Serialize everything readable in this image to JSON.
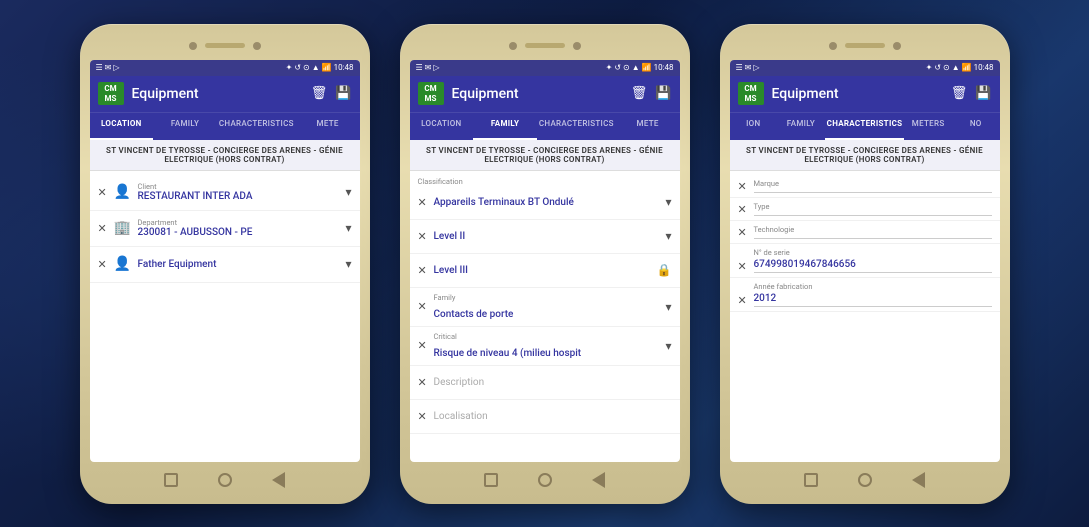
{
  "phones": [
    {
      "id": "phone1",
      "status_bar": {
        "left_icons": "☰ ✉ ▷",
        "right_icons": "✦ ↺ ⊙ ▲ 📶 🔋 10:48"
      },
      "header": {
        "logo_line1": "CM",
        "logo_line2": "MS",
        "title": "Equipment",
        "icon_trash": "🗑",
        "icon_save": "💾"
      },
      "tabs": [
        {
          "label": "LOCATION",
          "active": true
        },
        {
          "label": "FAMILY",
          "active": false
        },
        {
          "label": "CHARACTERISTICS",
          "active": false
        },
        {
          "label": "METE",
          "active": false
        }
      ],
      "breadcrumb": "ST VINCENT DE TYROSSE - CONCIERGE DES ARENES - GÉNIE ELECTRIQUE (HORS CONTRAT)",
      "rows": [
        {
          "type": "field",
          "label": "Client",
          "value": "RESTAURANT INTER ADA",
          "icon": "👤",
          "has_chevron": true
        },
        {
          "type": "field",
          "label": "Department",
          "value": "230081 - AUBUSSON - PE",
          "icon": "🏢",
          "has_chevron": true
        },
        {
          "type": "field",
          "label": "",
          "value": "Father Equipment",
          "icon": "👤",
          "has_chevron": true
        }
      ]
    },
    {
      "id": "phone2",
      "status_bar": {
        "left_icons": "☰ ✉ ▷",
        "right_icons": "✦ ↺ ⊙ ▲ 📶 🔋 10:48"
      },
      "header": {
        "logo_line1": "CM",
        "logo_line2": "MS",
        "title": "Equipment",
        "icon_trash": "🗑",
        "icon_save": "💾"
      },
      "tabs": [
        {
          "label": "LOCATION",
          "active": false
        },
        {
          "label": "FAMILY",
          "active": true
        },
        {
          "label": "CHARACTERISTICS",
          "active": false
        },
        {
          "label": "METE",
          "active": false
        }
      ],
      "breadcrumb": "ST VINCENT DE TYROSSE - CONCIERGE DES ARENES - GÉNIE ELECTRIQUE (HORS CONTRAT)",
      "classif_label": "Classification",
      "rows": [
        {
          "type": "classif",
          "value": "Appareils Terminaux BT Ondulé",
          "has_chevron": true,
          "locked": false
        },
        {
          "type": "classif",
          "value": "Level II",
          "has_chevron": true,
          "locked": false
        },
        {
          "type": "classif",
          "value": "Level III",
          "has_chevron": false,
          "locked": true
        },
        {
          "type": "field",
          "sub_label": "Family",
          "value": "Contacts de porte",
          "has_chevron": true,
          "locked": false
        },
        {
          "type": "field",
          "sub_label": "Critical",
          "value": "Risque de niveau 4 (milieu hospit",
          "has_chevron": true,
          "locked": false
        },
        {
          "type": "field",
          "sub_label": "",
          "value": "",
          "placeholder": "Description",
          "locked": false
        },
        {
          "type": "field",
          "sub_label": "",
          "value": "",
          "placeholder": "Localisation",
          "locked": false
        }
      ]
    },
    {
      "id": "phone3",
      "status_bar": {
        "left_icons": "☰ ✉ ▷",
        "right_icons": "✦ ↺ ⊙ ▲ 📶 🔋 10:48"
      },
      "header": {
        "logo_line1": "CM",
        "logo_line2": "MS",
        "title": "Equipment",
        "icon_trash": "🗑",
        "icon_save": "💾"
      },
      "tabs": [
        {
          "label": "ION",
          "active": false
        },
        {
          "label": "FAMILY",
          "active": false
        },
        {
          "label": "CHARACTERISTICS",
          "active": true
        },
        {
          "label": "METERS",
          "active": false
        },
        {
          "label": "NO",
          "active": false
        }
      ],
      "breadcrumb": "ST VINCENT DE TYROSSE - CONCIERGE DES ARENES - GÉNIE ELECTRIQUE (HORS CONTRAT)",
      "char_fields": [
        {
          "label": "Marque",
          "value": "",
          "placeholder": true
        },
        {
          "label": "Type",
          "value": "",
          "placeholder": true
        },
        {
          "label": "Technologie",
          "value": "",
          "placeholder": true
        },
        {
          "label": "N° de serie",
          "value": "674998019467846656",
          "placeholder": false
        },
        {
          "label": "Année fabrication",
          "value": "2012",
          "placeholder": false
        }
      ]
    }
  ],
  "nav": {
    "square": "□",
    "circle": "○",
    "back": "◁"
  }
}
